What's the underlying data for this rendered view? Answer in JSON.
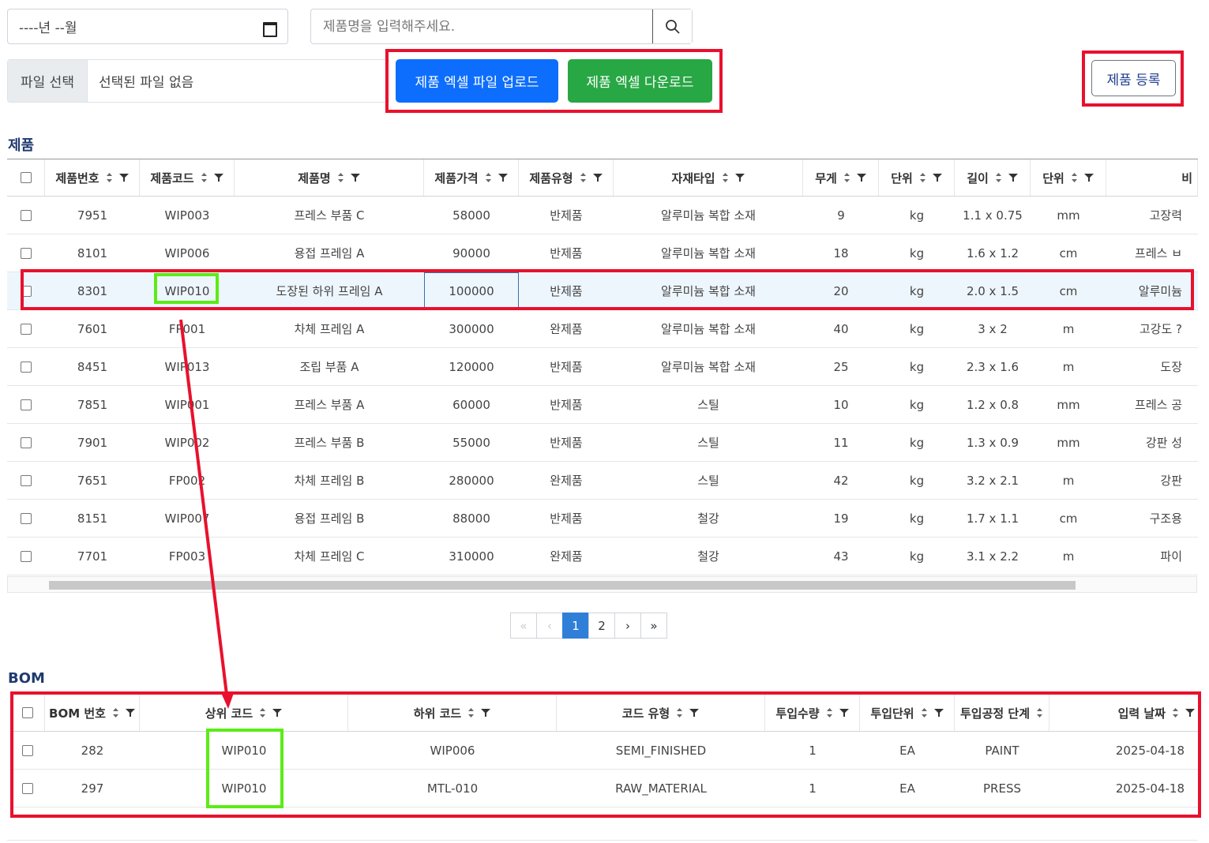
{
  "filters": {
    "month_value": "----년 --월",
    "search_placeholder": "제품명을 입력해주세요."
  },
  "file": {
    "choose_label": "파일 선택",
    "no_file_label": "선택된 파일 없음"
  },
  "buttons": {
    "upload": "제품 엑셀 파일 업로드",
    "download": "제품 엑셀 다운로드",
    "register": "제품 등록"
  },
  "colors": {
    "upload": "#0d6efd",
    "download": "#28a745",
    "highlight_red": "#e8112d",
    "highlight_green": "#5bec16"
  },
  "product_section": {
    "title": "제품",
    "columns": [
      "제품번호",
      "제품코드",
      "제품명",
      "제품가격",
      "제품유형",
      "자재타입",
      "무게",
      "단위",
      "길이",
      "단위",
      "비"
    ],
    "rows": [
      [
        "7951",
        "WIP003",
        "프레스 부품 C",
        "58000",
        "반제품",
        "알루미늄 복합 소재",
        "9",
        "kg",
        "1.1 x 0.75",
        "mm",
        "고장력"
      ],
      [
        "8101",
        "WIP006",
        "용접 프레임 A",
        "90000",
        "반제품",
        "알루미늄 복합 소재",
        "18",
        "kg",
        "1.6 x 1.2",
        "cm",
        "프레스 ㅂ"
      ],
      [
        "8301",
        "WIP010",
        "도장된 하위 프레임 A",
        "100000",
        "반제품",
        "알루미늄 복합 소재",
        "20",
        "kg",
        "2.0 x 1.5",
        "cm",
        "알루미늄"
      ],
      [
        "7601",
        "FP001",
        "차체 프레임 A",
        "300000",
        "완제품",
        "알루미늄 복합 소재",
        "40",
        "kg",
        "3 x 2",
        "m",
        "고강도 ?"
      ],
      [
        "8451",
        "WIP013",
        "조립 부품 A",
        "120000",
        "반제품",
        "알루미늄 복합 소재",
        "25",
        "kg",
        "2.3 x 1.6",
        "m",
        "도장"
      ],
      [
        "7851",
        "WIP001",
        "프레스 부품 A",
        "60000",
        "반제품",
        "스틸",
        "10",
        "kg",
        "1.2 x 0.8",
        "mm",
        "프레스 공"
      ],
      [
        "7901",
        "WIP002",
        "프레스 부품 B",
        "55000",
        "반제품",
        "스틸",
        "11",
        "kg",
        "1.3 x 0.9",
        "mm",
        "강판 성"
      ],
      [
        "7651",
        "FP002",
        "차체 프레임 B",
        "280000",
        "완제품",
        "스틸",
        "42",
        "kg",
        "3.2 x 2.1",
        "m",
        "강판"
      ],
      [
        "8151",
        "WIP007",
        "용접 프레임 B",
        "88000",
        "반제품",
        "철강",
        "19",
        "kg",
        "1.7 x 1.1",
        "cm",
        "구조용"
      ],
      [
        "7701",
        "FP003",
        "차체 프레임 C",
        "310000",
        "완제품",
        "철강",
        "43",
        "kg",
        "3.1 x 2.2",
        "m",
        "파이"
      ]
    ],
    "selected_row": 2
  },
  "pagination": {
    "first": "«",
    "prev": "‹",
    "pages": [
      "1",
      "2"
    ],
    "active_page": "1",
    "next": "›",
    "last": "»"
  },
  "bom_section": {
    "title": "BOM",
    "columns": [
      "BOM 번호",
      "상위 코드",
      "하위 코드",
      "코드 유형",
      "투입수량",
      "투입단위",
      "투입공정 단계",
      "입력 날짜"
    ],
    "rows": [
      [
        "282",
        "WIP010",
        "WIP006",
        "SEMI_FINISHED",
        "1",
        "EA",
        "PAINT",
        "2025-04-18"
      ],
      [
        "297",
        "WIP010",
        "MTL-010",
        "RAW_MATERIAL",
        "1",
        "EA",
        "PRESS",
        "2025-04-18"
      ]
    ]
  }
}
